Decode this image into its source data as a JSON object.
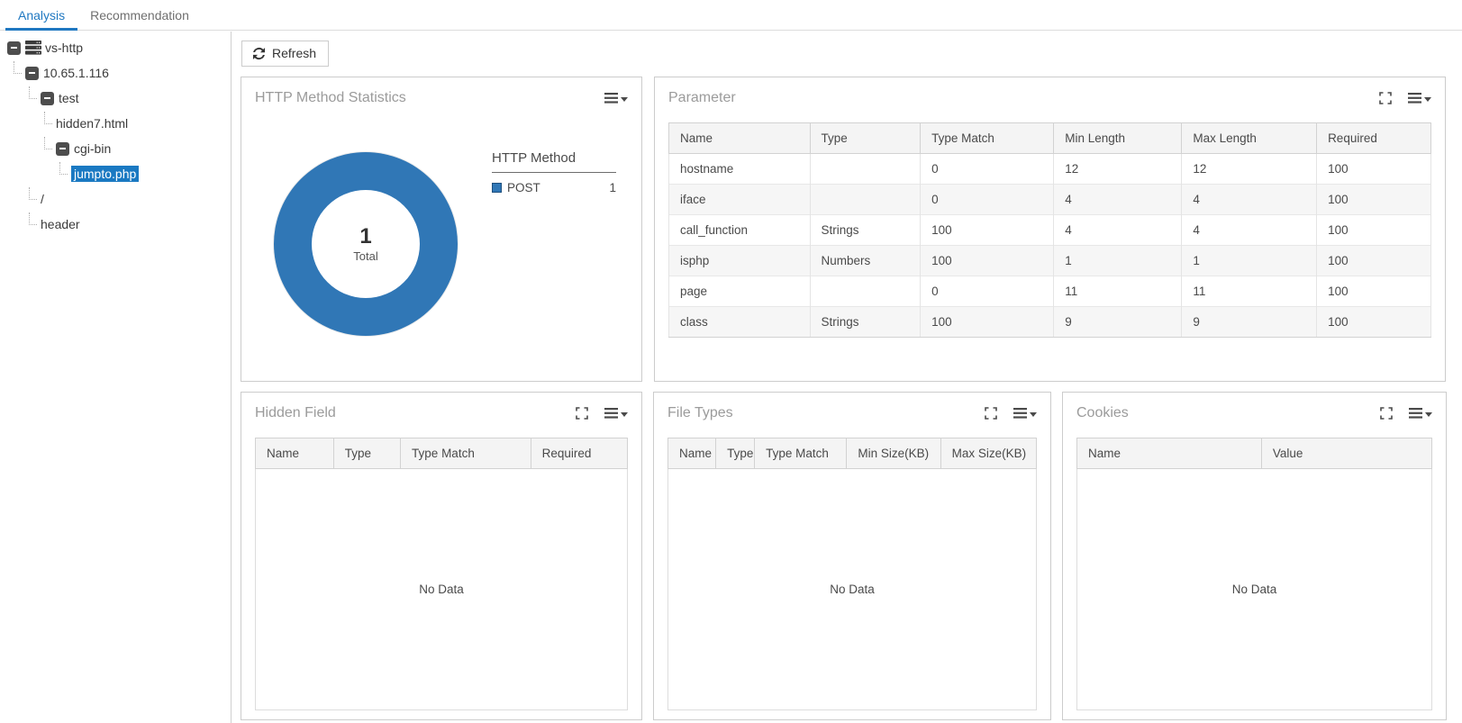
{
  "tabs": {
    "analysis": "Analysis",
    "recommendation": "Recommendation"
  },
  "tree": {
    "items": [
      {
        "label": "vs-http",
        "pad": 8,
        "connector": false,
        "expander": true,
        "icon": "server-stack-icon",
        "selected": false
      },
      {
        "label": "10.65.1.116",
        "pad": 15,
        "connector": true,
        "expander": true,
        "icon": null,
        "selected": false
      },
      {
        "label": "test",
        "pad": 32,
        "connector": true,
        "expander": true,
        "icon": null,
        "selected": false
      },
      {
        "label": "hidden7.html",
        "pad": 49,
        "connector": true,
        "expander": false,
        "icon": null,
        "selected": false
      },
      {
        "label": "cgi-bin",
        "pad": 49,
        "connector": true,
        "expander": true,
        "icon": null,
        "selected": false
      },
      {
        "label": "jumpto.php",
        "pad": 66,
        "connector": true,
        "expander": false,
        "icon": null,
        "selected": true
      },
      {
        "label": "/",
        "pad": 32,
        "connector": true,
        "expander": false,
        "icon": null,
        "selected": false
      },
      {
        "label": "header",
        "pad": 32,
        "connector": true,
        "expander": false,
        "icon": null,
        "selected": false
      }
    ]
  },
  "toolbar": {
    "refresh_label": "Refresh"
  },
  "chart_data": {
    "type": "pie",
    "donut": true,
    "title": "HTTP Method Statistics",
    "legend_title": "HTTP Method",
    "legend_position": "right",
    "series": [
      {
        "name": "POST",
        "value": 1,
        "color": "#3077b6"
      }
    ],
    "total_label": {
      "value": "1",
      "caption": "Total"
    }
  },
  "panels": {
    "http_method_statistics": {
      "title": "HTTP Method Statistics"
    },
    "parameter": {
      "title": "Parameter",
      "columns": [
        "Name",
        "Type",
        "Type Match",
        "Min Length",
        "Max Length",
        "Required"
      ],
      "col_widths": [
        "18.5%",
        "14.5%",
        "17.5%",
        "16.8%",
        "17.7%",
        "15%"
      ],
      "rows": [
        [
          "hostname",
          "",
          "0",
          "12",
          "12",
          "100"
        ],
        [
          "iface",
          "",
          "0",
          "4",
          "4",
          "100"
        ],
        [
          "call_function",
          "Strings",
          "100",
          "4",
          "4",
          "100"
        ],
        [
          "isphp",
          "Numbers",
          "100",
          "1",
          "1",
          "100"
        ],
        [
          "page",
          "",
          "0",
          "11",
          "11",
          "100"
        ],
        [
          "class",
          "Strings",
          "100",
          "9",
          "9",
          "100"
        ]
      ]
    },
    "hidden_field": {
      "title": "Hidden Field",
      "columns": [
        "Name",
        "Type",
        "Type Match",
        "Required"
      ],
      "col_widths": [
        "21%",
        "18%",
        "35%",
        "26%"
      ],
      "rows": [],
      "empty_text": "No Data"
    },
    "file_types": {
      "title": "File Types",
      "columns": [
        "Name",
        "Type",
        "Type Match",
        "Min Size(KB)",
        "Max Size(KB)"
      ],
      "col_widths": [
        "13%",
        "10.5%",
        "25%",
        "25.5%",
        "26%"
      ],
      "rows": [],
      "empty_text": "No Data"
    },
    "cookies": {
      "title": "Cookies",
      "columns": [
        "Name",
        "Value"
      ],
      "col_widths": [
        "52%",
        "48%"
      ],
      "rows": [],
      "empty_text": "No Data"
    }
  },
  "icons": {
    "refresh": "circular-arrows",
    "panel_menu": "hamburger-with-caret",
    "panel_expand": "fullscreen-corners",
    "tree_collapse": "minus-box",
    "vs_http": "server-stack"
  },
  "colors": {
    "accent_blue": "#1f78c1",
    "chart_blue": "#3077b6",
    "selected_item_bg": "#1a79c2",
    "panel_title": "#9b9b9b",
    "table_header_bg": "#f4f4f4",
    "row_alt_bg": "#f6f6f6",
    "panel_border": "#cccccc"
  }
}
